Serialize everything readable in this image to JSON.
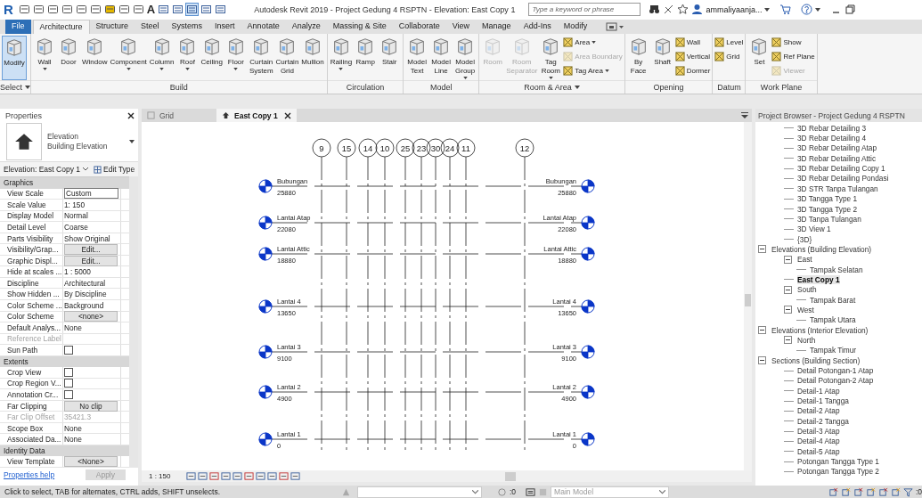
{
  "window": {
    "logo": "R",
    "quick_text": "A",
    "title": "Autodesk Revit 2019 - Project Gedung 4 RSPTN - Elevation: East Copy 1"
  },
  "search": {
    "placeholder": "Type a keyword or phrase"
  },
  "user": {
    "name": "ammaliyaanja..."
  },
  "ribbon_tabs": [
    {
      "label": "File",
      "kind": "file",
      "selected": false
    },
    {
      "label": "Architecture",
      "kind": "tab",
      "selected": true
    },
    {
      "label": "Structure",
      "kind": "tab",
      "selected": false
    },
    {
      "label": "Steel",
      "kind": "tab",
      "selected": false
    },
    {
      "label": "Systems",
      "kind": "tab",
      "selected": false
    },
    {
      "label": "Insert",
      "kind": "tab",
      "selected": false
    },
    {
      "label": "Annotate",
      "kind": "tab",
      "selected": false
    },
    {
      "label": "Analyze",
      "kind": "tab",
      "selected": false
    },
    {
      "label": "Massing & Site",
      "kind": "tab",
      "selected": false
    },
    {
      "label": "Collaborate",
      "kind": "tab",
      "selected": false
    },
    {
      "label": "View",
      "kind": "tab",
      "selected": false
    },
    {
      "label": "Manage",
      "kind": "tab",
      "selected": false
    },
    {
      "label": "Add-Ins",
      "kind": "tab",
      "selected": false
    },
    {
      "label": "Modify",
      "kind": "tab",
      "selected": false
    }
  ],
  "ribbon_panels": [
    {
      "title": "Select",
      "menu": true,
      "items": [
        {
          "kind": "large",
          "label": "Modify",
          "selected": true,
          "dropdown": false,
          "disabled": false
        }
      ]
    },
    {
      "title": "Build",
      "menu": false,
      "items": [
        {
          "kind": "large",
          "label": "Wall",
          "dropdown": true,
          "disabled": false
        },
        {
          "kind": "large",
          "label": "Door",
          "dropdown": false,
          "disabled": false
        },
        {
          "kind": "large",
          "label": "Window",
          "dropdown": false,
          "disabled": false
        },
        {
          "kind": "large",
          "label": "Component",
          "dropdown": true,
          "disabled": false
        },
        {
          "kind": "large",
          "label": "Column",
          "dropdown": true,
          "disabled": false
        },
        {
          "kind": "large",
          "label": "Roof",
          "dropdown": true,
          "disabled": false
        },
        {
          "kind": "large",
          "label": "Ceiling",
          "dropdown": false,
          "disabled": false
        },
        {
          "kind": "large",
          "label": "Floor",
          "dropdown": true,
          "disabled": false
        },
        {
          "kind": "large",
          "label": "Curtain System",
          "dropdown": false,
          "disabled": false
        },
        {
          "kind": "large",
          "label": "Curtain Grid",
          "dropdown": false,
          "disabled": false
        },
        {
          "kind": "large",
          "label": "Mullion",
          "dropdown": false,
          "disabled": false
        }
      ]
    },
    {
      "title": "Circulation",
      "menu": false,
      "items": [
        {
          "kind": "large",
          "label": "Railing",
          "dropdown": true,
          "disabled": false
        },
        {
          "kind": "large",
          "label": "Ramp",
          "dropdown": false,
          "disabled": false
        },
        {
          "kind": "large",
          "label": "Stair",
          "dropdown": false,
          "disabled": false
        }
      ]
    },
    {
      "title": "Model",
      "menu": false,
      "items": [
        {
          "kind": "large",
          "label": "Model Text",
          "dropdown": false,
          "disabled": false
        },
        {
          "kind": "large",
          "label": "Model Line",
          "dropdown": false,
          "disabled": false
        },
        {
          "kind": "large",
          "label": "Model Group",
          "dropdown": true,
          "disabled": false
        }
      ]
    },
    {
      "title": "Room & Area",
      "menu": true,
      "items": [
        {
          "kind": "large",
          "label": "Room",
          "dropdown": false,
          "disabled": true
        },
        {
          "kind": "large",
          "label": "Room Separator",
          "dropdown": false,
          "disabled": true
        },
        {
          "kind": "large",
          "label": "Tag Room",
          "dropdown": true,
          "disabled": false
        },
        {
          "kind": "stack",
          "items": [
            {
              "label": "Area",
              "dropdown": true,
              "disabled": false
            },
            {
              "label": "Area Boundary",
              "dropdown": false,
              "disabled": true
            },
            {
              "label": "Tag Area",
              "dropdown": true,
              "disabled": false
            }
          ]
        }
      ]
    },
    {
      "title": "Opening",
      "menu": false,
      "items": [
        {
          "kind": "large",
          "label": "By Face",
          "dropdown": false,
          "disabled": false
        },
        {
          "kind": "large",
          "label": "Shaft",
          "dropdown": false,
          "disabled": false
        },
        {
          "kind": "stack",
          "items": [
            {
              "label": "Wall",
              "dropdown": false,
              "disabled": false
            },
            {
              "label": "Vertical",
              "dropdown": false,
              "disabled": false
            },
            {
              "label": "Dormer",
              "dropdown": false,
              "disabled": false
            }
          ]
        }
      ]
    },
    {
      "title": "Datum",
      "menu": false,
      "items": [
        {
          "kind": "stack",
          "items": [
            {
              "label": "Level",
              "dropdown": false,
              "disabled": false
            },
            {
              "label": "Grid",
              "dropdown": false,
              "disabled": false
            }
          ]
        }
      ]
    },
    {
      "title": "Work Plane",
      "menu": false,
      "items": [
        {
          "kind": "large",
          "label": "Set",
          "dropdown": false,
          "disabled": false
        },
        {
          "kind": "stack",
          "items": [
            {
              "label": "Show",
              "dropdown": false,
              "disabled": false
            },
            {
              "label": "Ref Plane",
              "dropdown": false,
              "disabled": false
            },
            {
              "label": "Viewer",
              "dropdown": false,
              "disabled": true
            }
          ]
        }
      ]
    }
  ],
  "properties": {
    "title": "Properties",
    "type_name": "Elevation",
    "type_sub": "Building Elevation",
    "instance": "Elevation: East Copy 1",
    "edit_type": "Edit Type",
    "sections": [
      {
        "title": "Graphics",
        "rows": [
          {
            "name": "View Scale",
            "value": "Custom",
            "kind": "field",
            "disabled": false
          },
          {
            "name": "Scale Value",
            "value": "1: 150",
            "kind": "text",
            "disabled": false
          },
          {
            "name": "Display Model",
            "value": "Normal",
            "kind": "text",
            "disabled": false
          },
          {
            "name": "Detail Level",
            "value": "Coarse",
            "kind": "text",
            "disabled": false
          },
          {
            "name": "Parts Visibility",
            "value": "Show Original",
            "kind": "text",
            "disabled": false
          },
          {
            "name": "Visibility/Grap...",
            "value": "Edit...",
            "kind": "button",
            "disabled": false
          },
          {
            "name": "Graphic Displ...",
            "value": "Edit...",
            "kind": "button",
            "disabled": false
          },
          {
            "name": "Hide at scales ...",
            "value": "1 : 5000",
            "kind": "text",
            "disabled": false
          },
          {
            "name": "Discipline",
            "value": "Architectural",
            "kind": "text",
            "disabled": false
          },
          {
            "name": "Show Hidden ...",
            "value": "By Discipline",
            "kind": "text",
            "disabled": false
          },
          {
            "name": "Color Scheme ...",
            "value": "Background",
            "kind": "text",
            "disabled": false
          },
          {
            "name": "Color Scheme",
            "value": "<none>",
            "kind": "button",
            "disabled": false
          },
          {
            "name": "Default Analys...",
            "value": "None",
            "kind": "text",
            "disabled": false
          },
          {
            "name": "Reference Label",
            "kind": "text",
            "disabled": true
          },
          {
            "name": "Sun Path",
            "kind": "check",
            "checked": false,
            "disabled": false
          }
        ]
      },
      {
        "title": "Extents",
        "rows": [
          {
            "name": "Crop View",
            "kind": "check",
            "checked": false,
            "disabled": false
          },
          {
            "name": "Crop Region V...",
            "kind": "check",
            "checked": false,
            "disabled": false
          },
          {
            "name": "Annotation Cr...",
            "kind": "check",
            "checked": false,
            "disabled": false
          },
          {
            "name": "Far Clipping",
            "value": "No clip",
            "kind": "button",
            "disabled": false
          },
          {
            "name": "Far Clip Offset",
            "value": "35421.3",
            "kind": "text",
            "disabled": true
          },
          {
            "name": "Scope Box",
            "value": "None",
            "kind": "text",
            "disabled": false
          },
          {
            "name": "Associated Da...",
            "value": "None",
            "kind": "text",
            "disabled": false
          }
        ]
      },
      {
        "title": "Identity Data",
        "rows": [
          {
            "name": "View Template",
            "value": "<None>",
            "kind": "button",
            "disabled": false
          }
        ]
      }
    ],
    "help": "Properties help",
    "apply": "Apply",
    "apply_disabled": true
  },
  "view_tabs": [
    {
      "label": "Grid",
      "selected": false
    },
    {
      "label": "East Copy 1",
      "selected": true
    }
  ],
  "grids": [
    {
      "label": "9"
    },
    {
      "label": "15"
    },
    {
      "label": "14"
    },
    {
      "label": "10"
    },
    {
      "label": "25"
    },
    {
      "label": "23"
    },
    {
      "label": "30"
    },
    {
      "label": "24"
    },
    {
      "label": "11"
    },
    {
      "label": "12"
    }
  ],
  "levels": [
    {
      "left": {
        "name": "Bubungan",
        "elevation": "25880"
      },
      "right": {
        "name": "Bubungan",
        "elevation": "25880"
      }
    },
    {
      "left": {
        "name": "Lantai Atap",
        "elevation": "22080"
      },
      "right": {
        "name": "Lantai Atap",
        "elevation": "22080"
      }
    },
    {
      "left": {
        "name": "Lantai Attic",
        "elevation": "18880"
      },
      "right": {
        "name": "Lantai Attic",
        "elevation": "18880"
      }
    },
    {
      "left": {
        "name": "Lantai 4",
        "elevation": "13650"
      },
      "right": {
        "name": "Lantai 4",
        "elevation": "13650"
      }
    },
    {
      "left": {
        "name": "Lantai 3",
        "elevation": "9100"
      },
      "right": {
        "name": "Lantai 3",
        "elevation": "9100"
      }
    },
    {
      "left": {
        "name": "Lantai 2",
        "elevation": "4900"
      },
      "right": {
        "name": "Lantai 2",
        "elevation": "4900"
      }
    },
    {
      "left": {
        "name": "Lantai 1",
        "elevation": "0"
      },
      "right": {
        "name": "Lantai 1",
        "elevation": "0"
      }
    }
  ],
  "view_scale": "1 : 150",
  "browser": {
    "title": "Project Browser - Project Gedung 4 RSPTN",
    "items_above": [
      {
        "label": "3D Rebar Detailing 3",
        "selected": false
      },
      {
        "label": "3D Rebar Detailing 4",
        "selected": false
      },
      {
        "label": "3D Rebar Detailing Atap",
        "selected": false
      },
      {
        "label": "3D Rebar Detailing Attic",
        "selected": false
      },
      {
        "label": "3D Rebar Detailing Copy 1",
        "selected": false
      },
      {
        "label": "3D Rebar Detailing Pondasi",
        "selected": false
      },
      {
        "label": "3D STR Tanpa Tulangan",
        "selected": false
      },
      {
        "label": "3D Tangga Type 1",
        "selected": false
      },
      {
        "label": "3D Tangga Type 2",
        "selected": false
      },
      {
        "label": "3D Tanpa Tulangan",
        "selected": false
      },
      {
        "label": "3D View 1",
        "selected": false
      },
      {
        "label": "{3D}",
        "selected": false
      }
    ],
    "tree": [
      {
        "label": "Elevations (Building Elevation)",
        "expanded": true,
        "selected": false,
        "children": [
          {
            "label": "East",
            "expanded": true,
            "selected": false,
            "children": [
              {
                "label": "Tampak Selatan",
                "selected": false
              }
            ]
          },
          {
            "label": "East Copy 1",
            "selected": true
          },
          {
            "label": "South",
            "expanded": true,
            "selected": false,
            "children": [
              {
                "label": "Tampak Barat",
                "selected": false
              }
            ]
          },
          {
            "label": "West",
            "expanded": true,
            "selected": false,
            "children": [
              {
                "label": "Tampak Utara",
                "selected": false
              }
            ]
          }
        ]
      },
      {
        "label": "Elevations (Interior Elevation)",
        "expanded": true,
        "selected": false,
        "children": [
          {
            "label": "North",
            "expanded": true,
            "selected": false,
            "children": [
              {
                "label": "Tampak Timur",
                "selected": false
              }
            ]
          }
        ]
      },
      {
        "label": "Sections (Building Section)",
        "expanded": true,
        "selected": false,
        "children": [
          {
            "label": "Detail Potongan-1 Atap",
            "selected": false
          },
          {
            "label": "Detail Potongan-2 Atap",
            "selected": false
          },
          {
            "label": "Detail-1 Atap",
            "selected": false
          },
          {
            "label": "Detail-1 Tangga",
            "selected": false
          },
          {
            "label": "Detail-2 Atap",
            "selected": false
          },
          {
            "label": "Detail-2 Tangga",
            "selected": false
          },
          {
            "label": "Detail-3 Atap",
            "selected": false
          },
          {
            "label": "Detail-4 Atap",
            "selected": false
          },
          {
            "label": "Detail-5 Atap",
            "selected": false
          },
          {
            "label": "Potongan Tangga Type 1",
            "selected": false
          },
          {
            "label": "Potongan Tangga Type 2",
            "selected": false
          }
        ]
      }
    ]
  },
  "status": {
    "text": "Click to select, TAB for alternates, CTRL adds, SHIFT unselects.",
    "workset_count": ":0",
    "design_option": "Main Model",
    "filter_count": ":0"
  }
}
